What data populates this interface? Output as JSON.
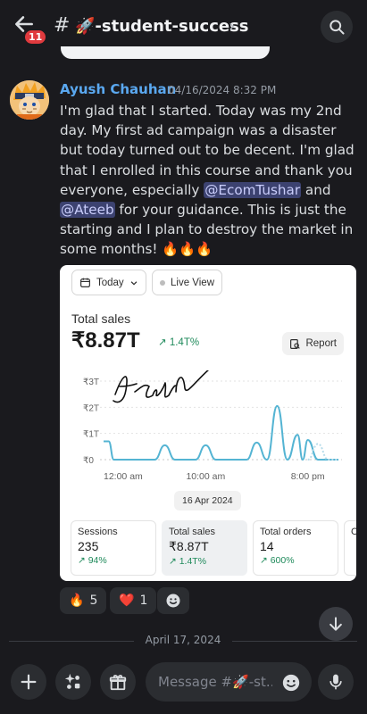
{
  "header": {
    "unread_count": "11",
    "hash": "#",
    "channel_name": "🚀-student-success",
    "chevron": "›",
    "icons": [
      "back-arrow-icon",
      "search-icon"
    ]
  },
  "message": {
    "author": "Ayush Chauhan",
    "timestamp": "04/16/2024 8:32 PM",
    "text_1": "I'm glad that I started. Today was my 2nd day. My first ad campaign was a disaster but today turned out to be decent. I'm glad that I enrolled in this course and thank you everyone, especially ",
    "mention_1": "@EcomTushar",
    "text_2": " and ",
    "mention_2": "@Ateeb",
    "text_3": " for your guidance. This is just the starting and I plan to destroy the market in some months! 🔥🔥🔥",
    "author_color": "#5aa8f0"
  },
  "embed": {
    "date_filter": "Today",
    "live_view": "Live View",
    "total_sales_label": "Total sales",
    "total_sales_value": "₹8.87T",
    "total_sales_change": "↗ 1.4T%",
    "report_label": "Report",
    "signature": "Ayush",
    "date_pill": "16 Apr 2024",
    "metrics": [
      {
        "label": "Sessions",
        "value": "235",
        "change": "↗ 94%"
      },
      {
        "label": "Total sales",
        "value": "₹8.87T",
        "change": "↗ 1.4T%"
      },
      {
        "label": "Total orders",
        "value": "14",
        "change": "↗ 600%"
      },
      {
        "label": "C",
        "value": "",
        "change": ""
      }
    ],
    "accent_color": "#54b4d3"
  },
  "chart_data": {
    "type": "line",
    "title": "Total sales",
    "y_ticks": [
      "₹0",
      "₹1T",
      "₹2T",
      "₹3T"
    ],
    "x_ticks": [
      "12:00 am",
      "10:00 am",
      "8:00 pm"
    ],
    "ylim": [
      0,
      3
    ],
    "series": [
      {
        "x": [
          0,
          0.5,
          1,
          2,
          3,
          4,
          5,
          6,
          7,
          8,
          9,
          10,
          11,
          12,
          13,
          14,
          15,
          16,
          17,
          18,
          19,
          19.5,
          20,
          21,
          22,
          23
        ],
        "values": [
          0.7,
          0.7,
          0,
          0,
          0,
          0,
          0,
          0.55,
          0,
          0,
          0,
          0.55,
          0,
          0,
          0,
          0,
          0.65,
          0,
          2.05,
          0,
          0.95,
          0,
          0.75,
          0,
          0,
          0
        ]
      },
      {
        "style": "dashed",
        "x": [
          20,
          21,
          22,
          23
        ],
        "values": [
          0,
          0.6,
          0,
          0
        ]
      }
    ]
  },
  "reactions": [
    {
      "emoji": "🔥",
      "count": "5"
    },
    {
      "emoji": "❤️",
      "count": "1"
    }
  ],
  "divider_date": "April 17, 2024",
  "composer": {
    "placeholder": "Message #🚀-st..."
  }
}
